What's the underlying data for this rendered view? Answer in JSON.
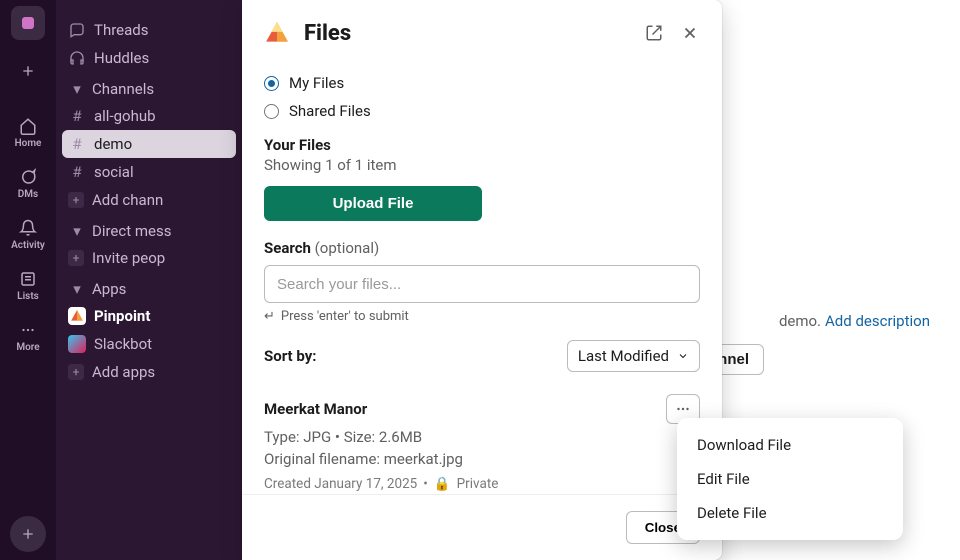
{
  "rail": {
    "home": "Home",
    "dms": "DMs",
    "activity": "Activity",
    "lists": "Lists",
    "more": "More"
  },
  "sidebar": {
    "threads": "Threads",
    "huddles": "Huddles",
    "channels_header": "Channels",
    "channels": [
      "all-gohub",
      "demo",
      "social"
    ],
    "add_channel": "Add chann",
    "dm_header": "Direct mess",
    "invite": "Invite peop",
    "apps_header": "Apps",
    "apps": [
      "Pinpoint",
      "Slackbot"
    ],
    "add_apps": "Add apps"
  },
  "background": {
    "desc_text": "demo.",
    "desc_link": "Add description",
    "join_button": "annel"
  },
  "modal": {
    "title": "Files",
    "radios": {
      "my_files": "My Files",
      "shared_files": "Shared Files"
    },
    "your_files_label": "Your Files",
    "count_text": "Showing 1 of 1 item",
    "upload_button": "Upload File",
    "search_label": "Search",
    "search_optional": "(optional)",
    "search_placeholder": "Search your files...",
    "search_hint": "Press 'enter' to submit",
    "sort_label": "Sort by:",
    "sort_value": "Last Modified",
    "file": {
      "title": "Meerkat Manor",
      "meta": "Type: JPG • Size: 2.6MB",
      "orig": "Original filename: meerkat.jpg",
      "created": "Created January 17, 2025",
      "privacy": "Private"
    },
    "close": "Close"
  },
  "menu": {
    "download": "Download File",
    "edit": "Edit File",
    "delete": "Delete File"
  }
}
